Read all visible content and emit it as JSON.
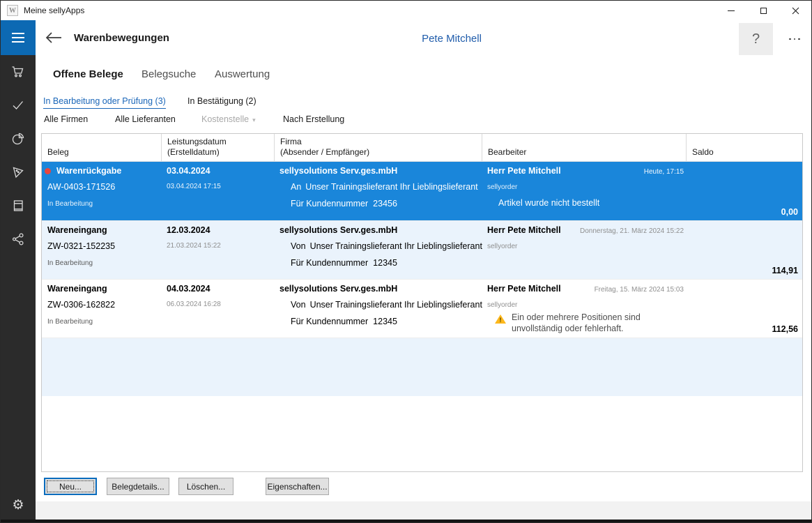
{
  "window": {
    "title": "Meine sellyApps",
    "app_icon_letter": "W"
  },
  "icons": {
    "minimize": "—",
    "maximize": "▢",
    "close": "✕",
    "help": "?",
    "more": "•••",
    "settings": "⚙",
    "caret": "▾",
    "back": "←",
    "sidebar": [
      "cart",
      "check",
      "pie-chart",
      "flag",
      "book",
      "share"
    ]
  },
  "header": {
    "title": "Warenbewegungen",
    "user": "Pete Mitchell"
  },
  "tabs": [
    {
      "label": "Offene Belege",
      "active": true
    },
    {
      "label": "Belegsuche",
      "active": false
    },
    {
      "label": "Auswertung",
      "active": false
    }
  ],
  "filters": {
    "status": [
      {
        "label": "In Bearbeitung oder Prüfung (3)",
        "active": true
      },
      {
        "label": "In Bestätigung (2)",
        "active": false
      }
    ],
    "buttons": [
      {
        "label": "Alle Firmen",
        "disabled": false,
        "has_caret": false
      },
      {
        "label": "Alle Lieferanten",
        "disabled": false,
        "has_caret": false
      },
      {
        "label": "Kostenstelle",
        "disabled": true,
        "has_caret": true
      },
      {
        "label": "Nach Erstellung",
        "disabled": false,
        "has_caret": false
      }
    ]
  },
  "table": {
    "columns": [
      {
        "line1": "Beleg",
        "line2": ""
      },
      {
        "line1": "Leistungsdatum",
        "line2": "(Erstelldatum)"
      },
      {
        "line1": "Firma",
        "line2": "(Absender / Empfänger)"
      },
      {
        "line1": "Bearbeiter",
        "line2": ""
      },
      {
        "line1": "Saldo",
        "line2": ""
      }
    ],
    "rows": [
      {
        "selected": true,
        "indicator_dot": true,
        "type": "Warenrückgabe",
        "number": "AW-0403-171526",
        "status": "In Bearbeitung",
        "date": "03.04.2024",
        "created": "03.04.2024 17:15",
        "company": "sellysolutions Serv.ges.mbH",
        "direction": "An",
        "partner": "Unser Trainingslieferant Ihr Lieblingslieferant",
        "customer_label": "Für Kundennummer",
        "customer_number": "23456",
        "editor": "Herr Pete Mitchell",
        "editor_app": "sellyorder",
        "timestamp": "Heute, 17:15",
        "note": "Artikel wurde nicht bestellt",
        "warning": "",
        "saldo": "0,00"
      },
      {
        "selected": false,
        "indicator_dot": false,
        "type": "Wareneingang",
        "number": "ZW-0321-152235",
        "status": "In Bearbeitung",
        "date": "12.03.2024",
        "created": "21.03.2024 15:22",
        "company": "sellysolutions Serv.ges.mbH",
        "direction": "Von",
        "partner": "Unser Trainingslieferant Ihr Lieblingslieferant",
        "customer_label": "Für Kundennummer",
        "customer_number": "12345",
        "editor": "Herr Pete Mitchell",
        "editor_app": "sellyorder",
        "timestamp": "Donnerstag, 21. März 2024 15:22",
        "note": "",
        "warning": "",
        "saldo": "114,91"
      },
      {
        "selected": false,
        "indicator_dot": false,
        "type": "Wareneingang",
        "number": "ZW-0306-162822",
        "status": "In Bearbeitung",
        "date": "04.03.2024",
        "created": "06.03.2024 16:28",
        "company": "sellysolutions Serv.ges.mbH",
        "direction": "Von",
        "partner": "Unser Trainingslieferant Ihr Lieblingslieferant",
        "customer_label": "Für Kundennummer",
        "customer_number": "12345",
        "editor": "Herr Pete Mitchell",
        "editor_app": "sellyorder",
        "timestamp": "Freitag, 15. März 2024 15:03",
        "note": "",
        "warning": "Ein oder mehrere Positionen sind unvollständig oder fehlerhaft.",
        "saldo": "112,56"
      }
    ]
  },
  "footer": {
    "buttons": [
      {
        "label": "Neu...",
        "focused": true
      },
      {
        "label": "Belegdetails...",
        "focused": false
      },
      {
        "label": "Löschen...",
        "focused": false
      },
      {
        "label": "Eigenschaften...",
        "focused": false
      }
    ]
  },
  "colors": {
    "accent_selected_row": "#1a86da",
    "hamburger": "#0c69b3",
    "sidebar": "#2b2b2b",
    "active_link": "#1a66b8",
    "user_name": "#1f5cab",
    "warning": "#fdb81c",
    "status_dot": "#e8463e",
    "alt_row": "#eaf3fc",
    "button_face": "#e1e1e1"
  }
}
